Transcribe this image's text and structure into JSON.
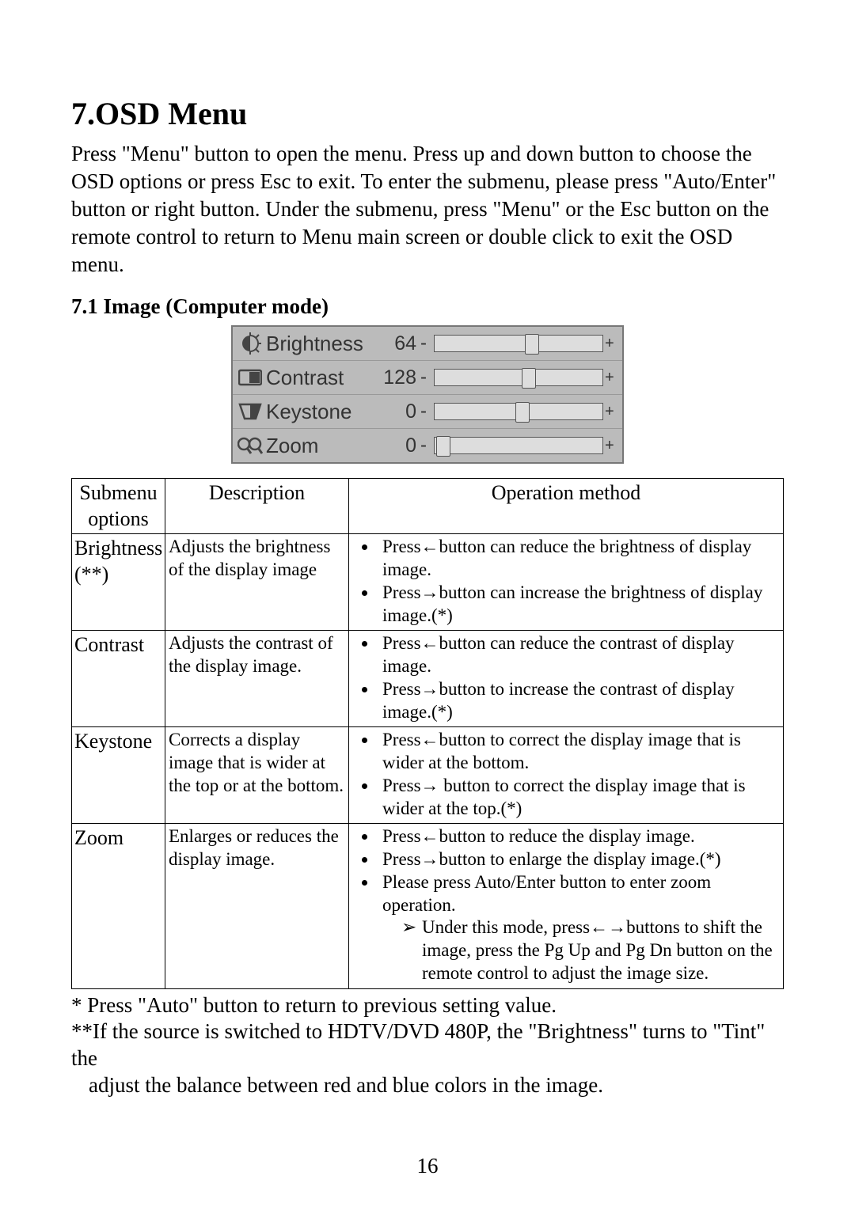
{
  "heading": "7.OSD Menu",
  "intro": "Press \"Menu\" button to open the menu. Press up and down button to choose the OSD options or press Esc to exit. To enter the submenu, please press \"Auto/Enter\" button or right button. Under the submenu, press \"Menu\" or the Esc button on the remote control to return to Menu main screen or double click to exit the OSD menu.",
  "subheading": "7.1 Image (Computer mode)",
  "osd": {
    "minus": "-",
    "plus": "+",
    "rows": {
      "brightness": {
        "label": "Brightness",
        "value": "64",
        "thumb_pct": 54
      },
      "contrast": {
        "label": "Contrast",
        "value": "128",
        "thumb_pct": 52
      },
      "keystone": {
        "label": "Keystone",
        "value": "0",
        "thumb_pct": 48
      },
      "zoom": {
        "label": "Zoom",
        "value": "0",
        "thumb_pct": 1
      }
    }
  },
  "table": {
    "headers": {
      "submenu": "Submenu options",
      "description": "Description",
      "operation": "Operation method"
    },
    "brightness": {
      "submenu": "Brightness (**)",
      "desc": "Adjusts the brightness of the display image",
      "op1": "Press←button can reduce the brightness of display image.",
      "op2": "Press→button can increase the brightness of display image.(*)"
    },
    "contrast": {
      "submenu": "Contrast",
      "desc": "Adjusts the contrast of the display image.",
      "op1": "Press←button can reduce the contrast of display image.",
      "op2": "Press→button to increase the contrast of display image.(*)"
    },
    "keystone": {
      "submenu": "Keystone",
      "desc": "Corrects a display image that is wider at the top or at the bottom.",
      "op1": "Press←button to correct the display image that is wider at the bottom.",
      "op2": "Press→ button to correct the display image that is wider at the top.(*)"
    },
    "zoom": {
      "submenu": "Zoom",
      "desc": "Enlarges or reduces the display image.",
      "op1": "Press←button to reduce the display image.",
      "op2": "Press→button to enlarge the display image.(*)",
      "op3": "Please press Auto/Enter button to enter zoom operation.",
      "op3sub": "Under this mode, press←→buttons to shift the image, press the Pg Up and Pg Dn button on the remote control to adjust the image size."
    }
  },
  "notes": {
    "n1": "* Press \"Auto\" button to return to previous setting value.",
    "n2a": "**If the source is switched to HDTV/DVD 480P, the \"Brightness\" turns to \"Tint\" the",
    "n2b": "adjust the balance between red and blue colors in the image."
  },
  "page_number": "16"
}
